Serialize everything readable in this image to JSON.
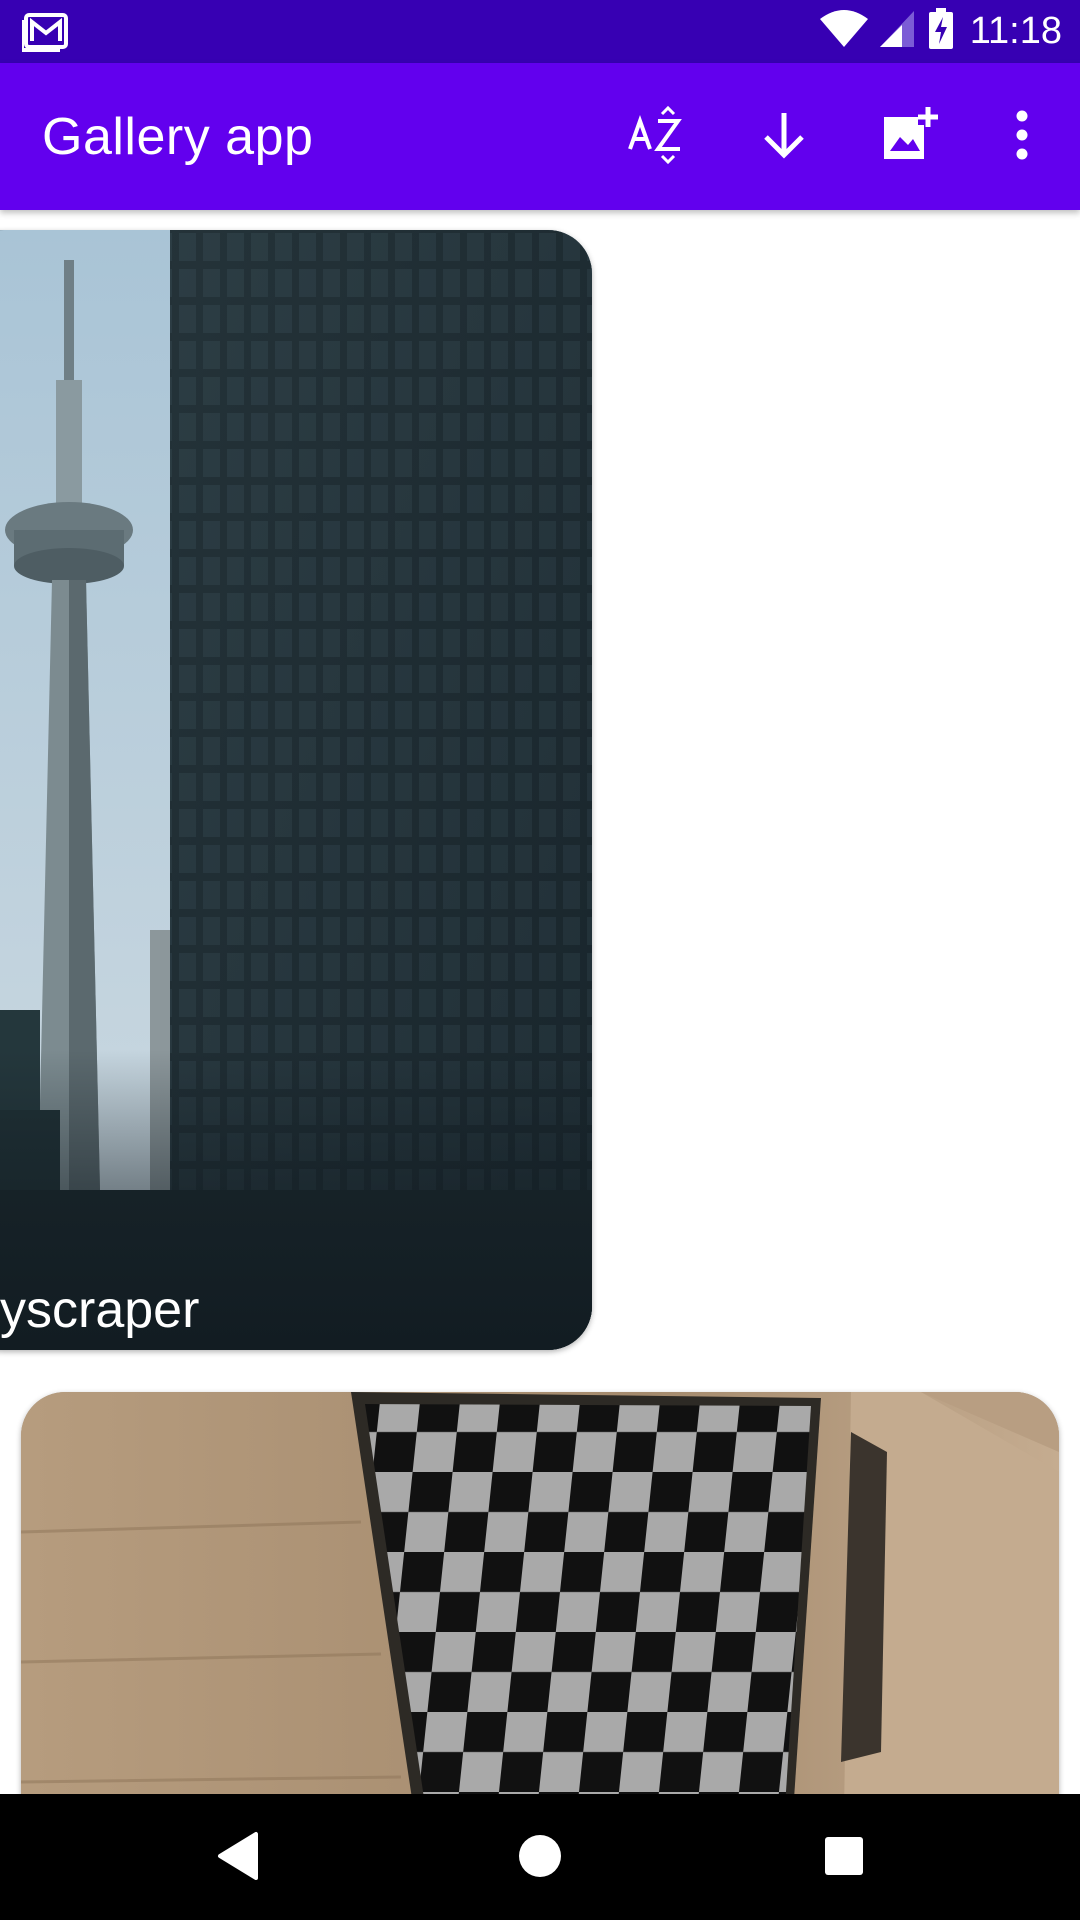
{
  "status_bar": {
    "time": "11:18",
    "notification_icon": "gmail-icon",
    "icons": [
      "wifi-icon",
      "signal-icon",
      "battery-charging-icon"
    ]
  },
  "app_bar": {
    "title": "Gallery app",
    "actions": [
      {
        "name": "sort-az-icon",
        "label": "Sort A-Z"
      },
      {
        "name": "download-icon",
        "label": "Download"
      },
      {
        "name": "add-photo-icon",
        "label": "Add photo"
      },
      {
        "name": "overflow-menu-icon",
        "label": "More options"
      }
    ]
  },
  "gallery": {
    "items": [
      {
        "caption": "yscraper"
      },
      {
        "caption": ""
      }
    ]
  },
  "nav_bar": {
    "buttons": [
      "back-icon",
      "home-icon",
      "recents-icon"
    ]
  },
  "colors": {
    "status_bar": "#3700b3",
    "app_bar": "#6200ee",
    "nav_bar": "#000000"
  }
}
